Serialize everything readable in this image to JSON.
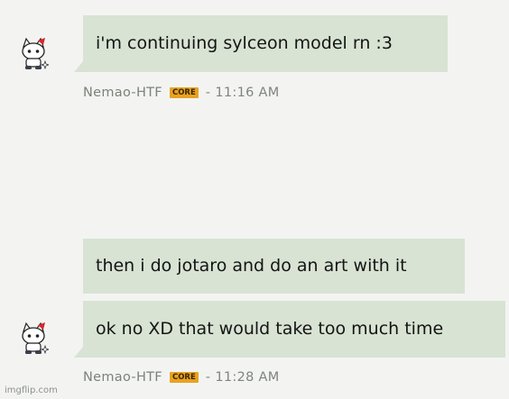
{
  "messages": [
    {
      "text": "i'm continuing sylceon model rn :3",
      "author": "Nemao-HTF",
      "badge": "CORE",
      "separator": "-",
      "time": "11:16 AM"
    },
    {
      "text": "then i do jotaro and do an art with it"
    },
    {
      "text": "ok no XD that would take too much time",
      "author": "Nemao-HTF",
      "badge": "CORE",
      "separator": "-",
      "time": "11:28 AM"
    }
  ],
  "watermark": "imgflip.com",
  "colors": {
    "background": "#f3f4f2",
    "bubble": "#d8e3d3",
    "core_badge": "#e8a222",
    "meta_text": "#7f857d"
  },
  "icons": {
    "avatar": "cat-avatar-icon"
  }
}
